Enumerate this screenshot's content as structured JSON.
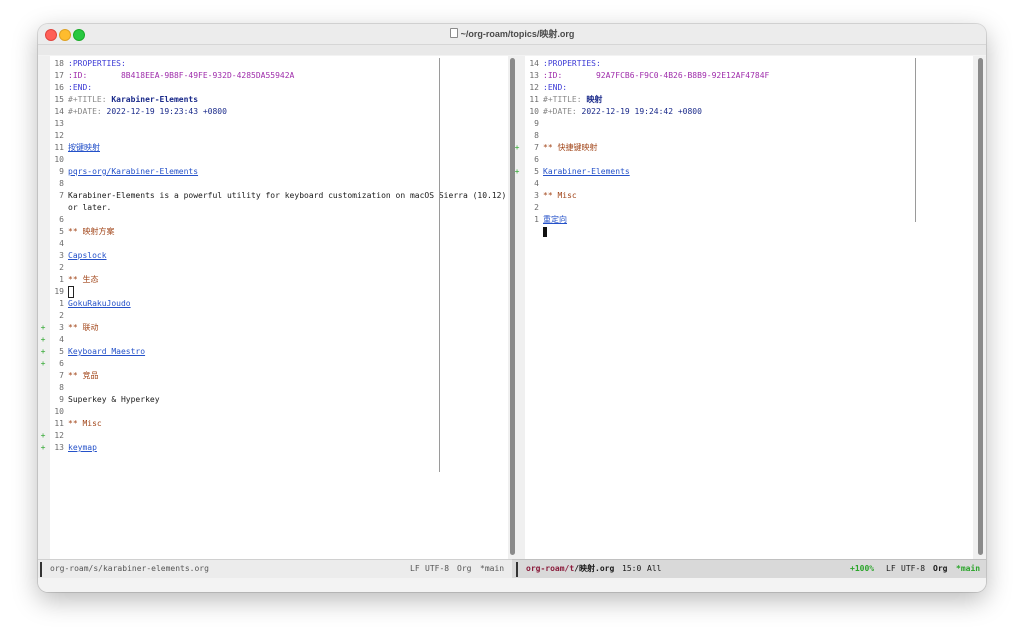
{
  "window": {
    "title": "~/org-roam/topics/映射.org"
  },
  "left_pane": {
    "lines": [
      {
        "num": "18",
        "text": ":PROPERTIES:",
        "kind": "kw"
      },
      {
        "num": "17",
        "text": ":ID:       8B418EEA-9B8F-49FE-932D-4285DA55942A",
        "kind": "id"
      },
      {
        "num": "16",
        "text": ":END:",
        "kind": "kw"
      },
      {
        "num": "15",
        "prefix": "#+TITLE: ",
        "text": "Karabiner-Elements",
        "kind": "title"
      },
      {
        "num": "14",
        "prefix": "#+DATE: ",
        "text": "2022-12-19 19:23:43 +0800",
        "kind": "date"
      },
      {
        "num": "13",
        "text": "",
        "kind": "plain"
      },
      {
        "num": "12",
        "text": "",
        "kind": "plain"
      },
      {
        "num": "11",
        "text": "按键映射",
        "kind": "link"
      },
      {
        "num": "10",
        "text": "",
        "kind": "plain"
      },
      {
        "num": "9",
        "text": "pqrs-org/Karabiner-Elements",
        "kind": "link"
      },
      {
        "num": "8",
        "text": "",
        "kind": "plain"
      },
      {
        "num": "7",
        "text": "Karabiner-Elements is a powerful utility for keyboard customization on macOS Sierra (10.12)",
        "kind": "plain"
      },
      {
        "num": "",
        "text": "or later.",
        "kind": "plain"
      },
      {
        "num": "6",
        "text": "",
        "kind": "plain"
      },
      {
        "num": "5",
        "text": "** 映射方案",
        "kind": "heading"
      },
      {
        "num": "4",
        "text": "",
        "kind": "plain"
      },
      {
        "num": "3",
        "text": "Capslock",
        "kind": "link"
      },
      {
        "num": "2",
        "text": "",
        "kind": "plain"
      },
      {
        "num": "1",
        "text": "** 生态",
        "kind": "heading"
      },
      {
        "num": "19",
        "text": "",
        "kind": "cursor"
      },
      {
        "num": "1",
        "text": "GokuRakuJoudo",
        "kind": "link"
      },
      {
        "num": "2",
        "text": "",
        "kind": "plain"
      },
      {
        "num": "3",
        "text": "** 联动",
        "kind": "heading",
        "diff": "+"
      },
      {
        "num": "4",
        "text": "",
        "kind": "plain",
        "diff": "+"
      },
      {
        "num": "5",
        "text": "Keyboard Maestro",
        "kind": "link",
        "diff": "+"
      },
      {
        "num": "6",
        "text": "",
        "kind": "plain",
        "diff": "+"
      },
      {
        "num": "7",
        "text": "** 竞品",
        "kind": "heading"
      },
      {
        "num": "8",
        "text": "",
        "kind": "plain"
      },
      {
        "num": "9",
        "text": "Superkey & Hyperkey",
        "kind": "plain"
      },
      {
        "num": "10",
        "text": "",
        "kind": "plain"
      },
      {
        "num": "11",
        "text": "** Misc",
        "kind": "heading"
      },
      {
        "num": "12",
        "text": "",
        "kind": "plain",
        "diff": "+"
      },
      {
        "num": "13",
        "text": "keymap",
        "kind": "link",
        "diff": "+"
      }
    ]
  },
  "right_pane": {
    "lines": [
      {
        "num": "14",
        "text": ":PROPERTIES:",
        "kind": "kw"
      },
      {
        "num": "13",
        "text": ":ID:       92A7FCB6-F9C0-4B26-B8B9-92E12AF4784F",
        "kind": "id"
      },
      {
        "num": "12",
        "text": ":END:",
        "kind": "kw"
      },
      {
        "num": "11",
        "prefix": "#+TITLE: ",
        "text": "映射",
        "kind": "title"
      },
      {
        "num": "10",
        "prefix": "#+DATE: ",
        "text": "2022-12-19 19:24:42 +0800",
        "kind": "date"
      },
      {
        "num": "9",
        "text": "",
        "kind": "plain"
      },
      {
        "num": "8",
        "text": "",
        "kind": "plain"
      },
      {
        "num": "7",
        "text": "** 快捷键映射",
        "kind": "heading",
        "diff": "+"
      },
      {
        "num": "6",
        "text": "",
        "kind": "plain"
      },
      {
        "num": "5",
        "text": "Karabiner-Elements",
        "kind": "link",
        "diff": "+"
      },
      {
        "num": "4",
        "text": "",
        "kind": "plain"
      },
      {
        "num": "3",
        "text": "** Misc",
        "kind": "heading"
      },
      {
        "num": "2",
        "text": "",
        "kind": "plain"
      },
      {
        "num": "1",
        "text": "重定向",
        "kind": "link"
      },
      {
        "num": "",
        "text": "",
        "kind": "blockcursor"
      }
    ]
  },
  "modeline_left": {
    "path": "org-roam/s/karabiner-elements.org",
    "eol": "LF",
    "encoding": "UTF-8",
    "mode": "Org",
    "branch": "*main"
  },
  "modeline_right": {
    "path_prefix": "org-roam/",
    "path_dir": "t",
    "path_sep": "/",
    "path_file": "映射.org",
    "position": "15:0",
    "extent": "All",
    "percent": "+100%",
    "eol": "LF",
    "encoding": "UTF-8",
    "mode": "Org",
    "branch": "*main"
  },
  "colors": {
    "keyword": "#3d3bd6",
    "heading": "#a2461a",
    "link": "#2451c9",
    "diff_add": "#2aa52a",
    "branch_active": "#2aa52a"
  }
}
